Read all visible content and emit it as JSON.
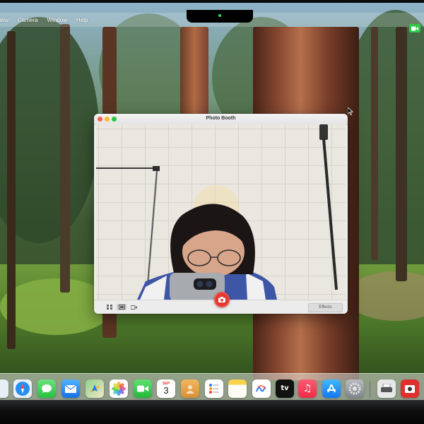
{
  "menubar": {
    "items": [
      "View",
      "Camera",
      "Window",
      "Help"
    ],
    "visible_items": [
      "iew",
      "Camera",
      "Window",
      "Help"
    ]
  },
  "status": {
    "facetime_icon": "video-camera-icon",
    "facetime_color": "#2fc94a"
  },
  "photo_booth": {
    "title": "Photo Booth",
    "effects_label": "Effects",
    "shutter_color": "#e23a2f",
    "view_modes": [
      "grid-view-icon",
      "single-photo-icon",
      "video-icon"
    ]
  },
  "dock": {
    "calendar": {
      "month": "SEP",
      "day": "3"
    },
    "apple_tv_label": "tv",
    "apps": [
      "Finder",
      "Safari",
      "Messages",
      "Mail",
      "Maps",
      "Photos",
      "FaceTime",
      "Calendar",
      "Contacts",
      "Reminders",
      "Notes",
      "Freeform",
      "Apple TV",
      "Music",
      "App Store",
      "System Settings",
      "Preview",
      "Photo Booth"
    ]
  },
  "colors": {
    "accent_red": "#e23a2f",
    "menubar_text": "#ffffff"
  }
}
